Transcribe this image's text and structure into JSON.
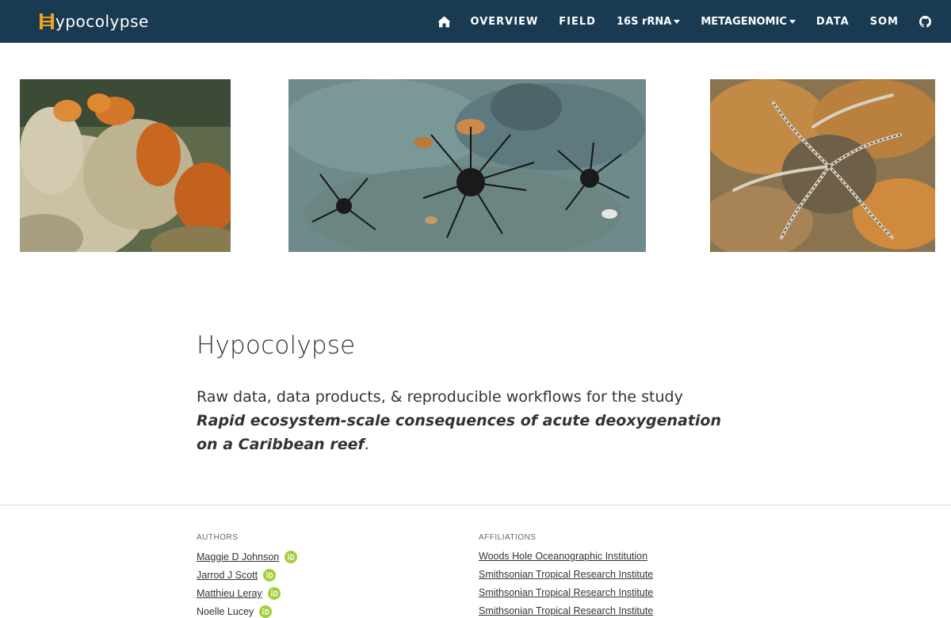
{
  "brand": {
    "name": "ypocolypse"
  },
  "nav": {
    "items": [
      "OVERVIEW",
      "FIELD",
      "16S rRNA",
      "METAGENOMIC",
      "DATA",
      "SOM"
    ]
  },
  "hero": {
    "title": "Hypocolypse",
    "lead_prefix": "Raw data, data products, & reproducible workflows for the study ",
    "lead_emph": "Rapid ecosystem-scale consequences of acute deoxygenation on a Caribbean reef",
    "lead_suffix": "."
  },
  "authors": {
    "heading": "AUTHORS",
    "list": [
      "Maggie D Johnson",
      "Jarrod J Scott",
      "Matthieu Leray",
      "Noelle Lucey"
    ]
  },
  "affiliations": {
    "heading": "AFFILIATIONS",
    "list": [
      "Woods Hole Oceanographic Institution",
      "Smithsonian Tropical Research Institute",
      "Smithsonian Tropical Research Institute",
      "Smithsonian Tropical Research Institute"
    ]
  },
  "colors": {
    "navbar": "#1a3a52",
    "orcid": "#a6ce39",
    "brand_accent": "#f0a21a"
  }
}
